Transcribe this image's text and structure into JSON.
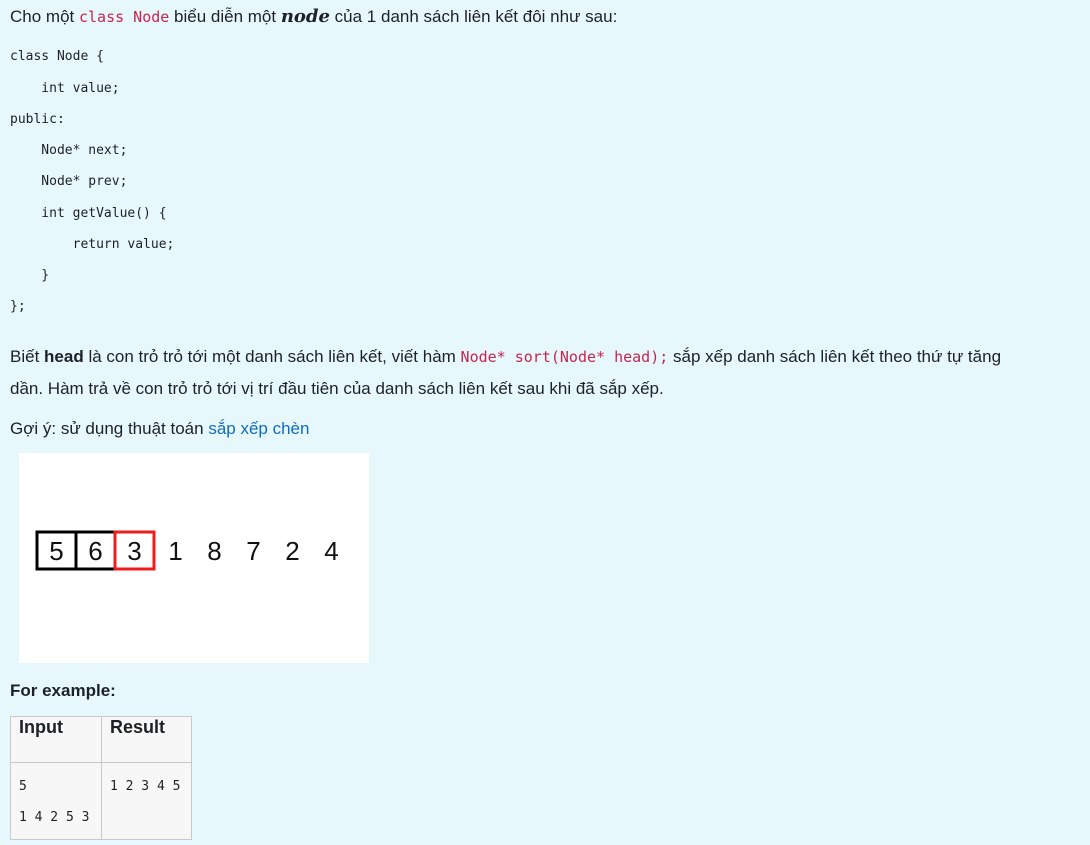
{
  "intro": {
    "text1": "Cho một ",
    "code1": "class Node",
    "text2": " biểu diễn một ",
    "italic": "node",
    "text3": " của 1 danh sách liên kết đôi như sau:"
  },
  "code_lines": [
    "class Node {",
    "    int value;",
    "public:",
    "    Node* next;",
    "    Node* prev;",
    "    int getValue() {",
    "        return value;",
    "    }",
    "};"
  ],
  "task": {
    "t1": "Biết ",
    "bold": "head",
    "t2": " là con trỏ trỏ tới một danh sách liên kết, viết hàm ",
    "code": "Node* sort(Node* head);",
    "t3": " sắp xếp danh sách liên kết theo thứ tự tăng",
    "line2": "dần. Hàm trả về con trỏ trỏ tới vị trí đầu tiên của danh sách liên kết sau khi đã sắp xếp."
  },
  "hint": {
    "prefix": "Gợi ý: sử dụng thuật toán ",
    "link": "sắp xếp chèn"
  },
  "figure": {
    "boxed": [
      "5",
      "6",
      "3"
    ],
    "rest": [
      "1",
      "8",
      "7",
      "2",
      "4"
    ],
    "box_color": "#000000",
    "highlight_color": "#ee1c1c"
  },
  "example": {
    "heading": "For example:",
    "headers": [
      "Input",
      "Result"
    ],
    "input": "5\n1 4 2 5 3",
    "result": "1 2 3 4 5"
  }
}
